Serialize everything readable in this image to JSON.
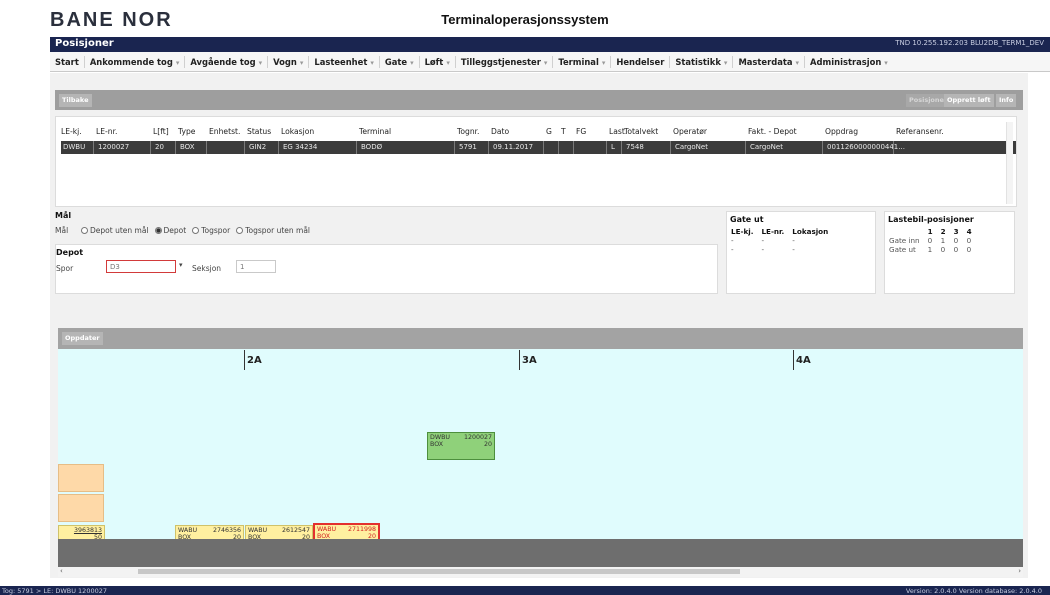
{
  "header": {
    "logo_text": "BANE NOR",
    "app_title": "Terminaloperasjonssystem",
    "page_title": "Posisjoner",
    "connection_info": "TND 10.255.192.203 BLU2DB_TERM1_DEV"
  },
  "menu": [
    {
      "label": "Start",
      "caret": ""
    },
    {
      "label": "Ankommende tog",
      "caret": "▾"
    },
    {
      "label": "Avgående tog",
      "caret": "▾"
    },
    {
      "label": "Vogn",
      "caret": "▾"
    },
    {
      "label": "Lasteenhet",
      "caret": "▾"
    },
    {
      "label": "Gate",
      "caret": "▾"
    },
    {
      "label": "Løft",
      "caret": "▾"
    },
    {
      "label": "Tilleggstjenester",
      "caret": "▾"
    },
    {
      "label": "Terminal",
      "caret": "▾"
    },
    {
      "label": "Hendelser",
      "caret": ""
    },
    {
      "label": "Statistikk",
      "caret": "▾"
    },
    {
      "label": "Masterdata",
      "caret": "▾"
    },
    {
      "label": "Administrasjon",
      "caret": "▾"
    }
  ],
  "toolbar": {
    "back": "Tilbake",
    "posisjoner": "Posisjoner",
    "opprett_loft": "Opprett løft",
    "info": "Info"
  },
  "grid": {
    "columns": [
      "LE-kj.",
      "LE-nr.",
      "L[ft]",
      "Type",
      "Enhetst.",
      "Status",
      "Lokasjon",
      "Terminal",
      "Tognr.",
      "Dato",
      "G",
      "T",
      "FG",
      "Last.",
      "Totalvekt",
      "Operatør",
      "Fakt. - Depot",
      "Oppdrag",
      "Referansenr."
    ],
    "row": [
      "DWBU",
      "1200027",
      "20",
      "BOX",
      "",
      "GIN2",
      "EG 34234",
      "BODØ",
      "5791",
      "09.11.2017",
      "",
      "",
      "",
      "L",
      "7548",
      "CargoNet",
      "CargoNet",
      "0011260000000441...",
      ""
    ]
  },
  "maal": {
    "heading": "Mål",
    "label": "Mål",
    "options": [
      "Depot uten mål",
      "Depot",
      "Togspor",
      "Togspor uten mål"
    ],
    "selected": "Depot"
  },
  "depot": {
    "heading": "Depot",
    "spor_label": "Spor",
    "spor_value": "D3",
    "seksjon_label": "Seksjon",
    "seksjon_value": "1"
  },
  "gate_ut": {
    "heading": "Gate ut",
    "columns": [
      "LE-kj.",
      "LE-nr.",
      "Lokasjon"
    ],
    "rows": [
      [
        "-",
        "-",
        "-"
      ],
      [
        "-",
        "-",
        "-"
      ]
    ]
  },
  "lastebil": {
    "heading": "Lastebil-posisjoner",
    "columns": [
      "",
      "1",
      "2",
      "3",
      "4"
    ],
    "rows": [
      [
        "Gate inn",
        "0",
        "1",
        "0",
        "0"
      ],
      [
        "Gate ut",
        "1",
        "0",
        "0",
        "0"
      ]
    ]
  },
  "yard": {
    "update_button": "Oppdater",
    "sections": [
      "2A",
      "3A",
      "4A"
    ],
    "units": [
      {
        "kj": "DWBU",
        "nr": "1200027",
        "type": "BOX",
        "len": "20",
        "color": "green"
      },
      {
        "kj": "",
        "nr": "3963813",
        "type": "",
        "len": "50",
        "color": "yellow"
      },
      {
        "kj": "WABU",
        "nr": "2746356",
        "type": "BOX",
        "len": "20",
        "color": "yellow"
      },
      {
        "kj": "WABU",
        "nr": "2612547",
        "type": "BOX",
        "len": "20",
        "color": "yellow"
      },
      {
        "kj": "WABU",
        "nr": "2711998",
        "type": "BOX",
        "len": "20",
        "color": "yellow",
        "selected": true
      }
    ]
  },
  "status": {
    "left": "Tog: 5791 > LE: DWBU 1200027",
    "right": "Version: 2.0.4.0 Version database: 2.0.4.0"
  }
}
